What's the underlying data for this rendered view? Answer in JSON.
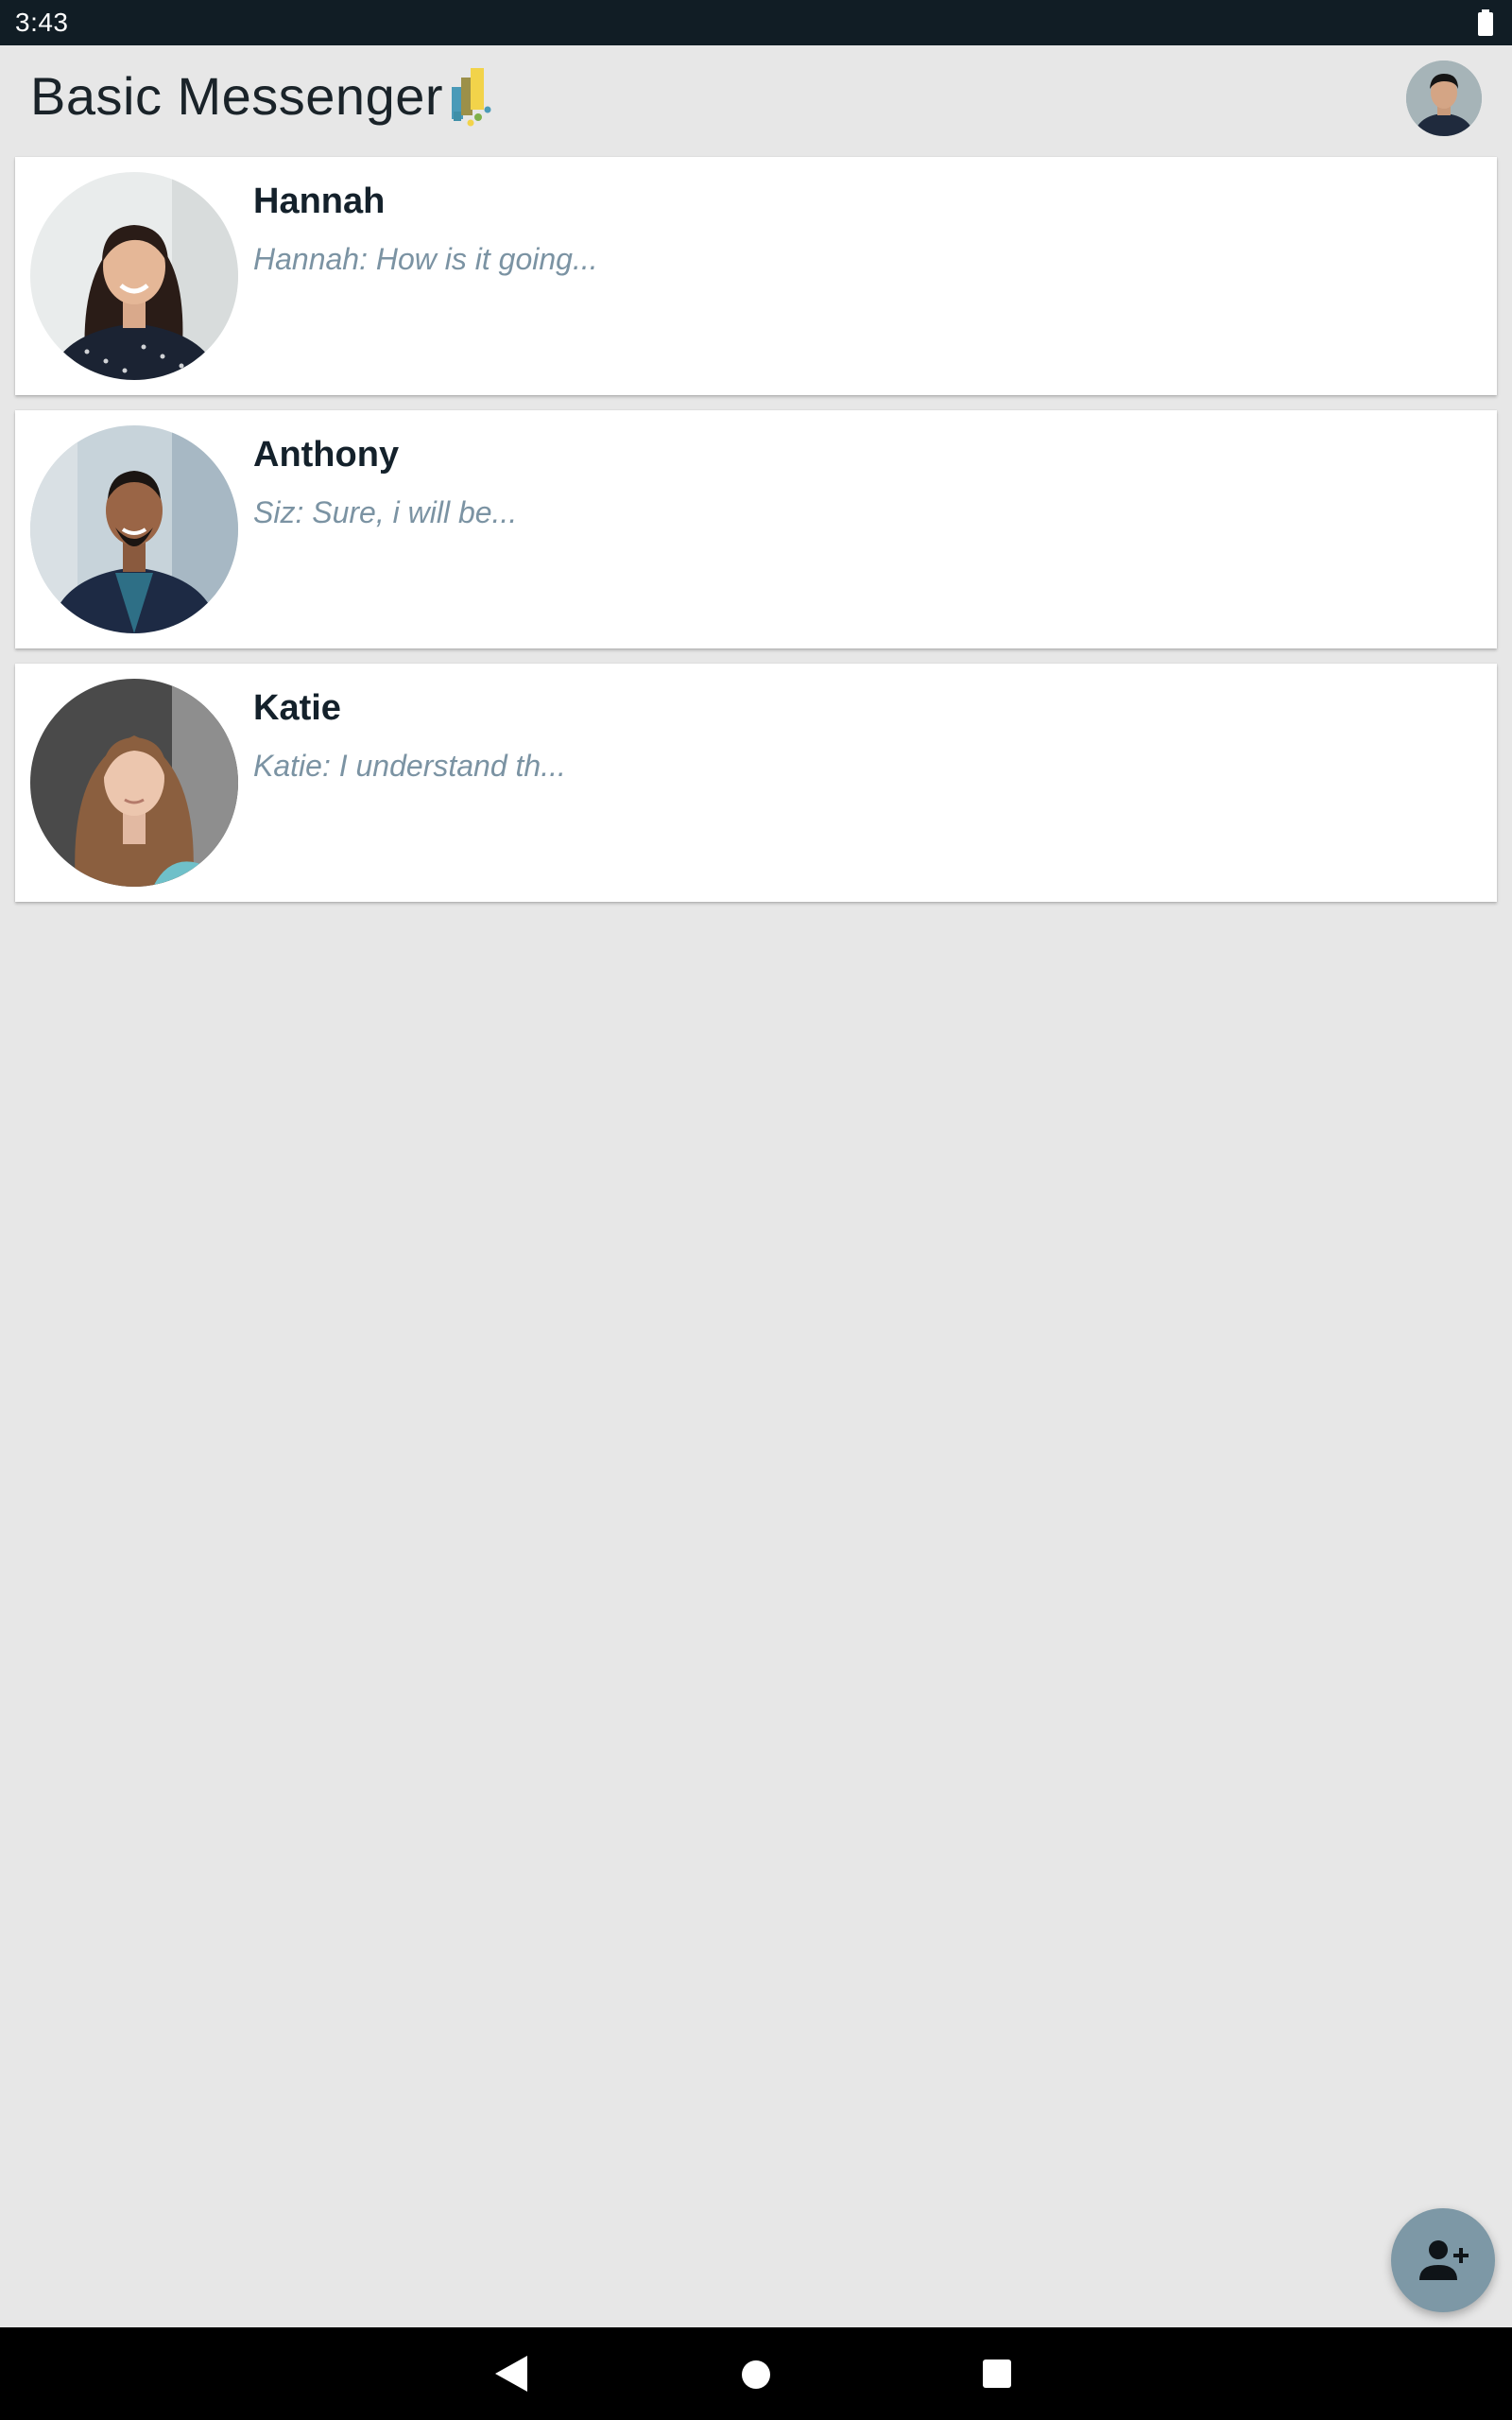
{
  "status_bar": {
    "time": "3:43",
    "battery_icon": "battery-full-icon"
  },
  "header": {
    "title": "Basic Messenger",
    "logo_icon": "app-logo-icon",
    "profile_avatar": "user-avatar"
  },
  "conversations": [
    {
      "name": "Hannah",
      "preview": "Hannah: How is it going..."
    },
    {
      "name": "Anthony",
      "preview": "Siz: Sure, i will be..."
    },
    {
      "name": "Katie",
      "preview": "Katie: I understand th..."
    }
  ],
  "fab": {
    "icon": "person-add-icon",
    "color": "#7d98a6"
  },
  "nav": {
    "back_icon": "back-icon",
    "home_icon": "home-icon",
    "recents_icon": "recents-icon"
  },
  "colors": {
    "background": "#e7e7e7",
    "status_bar": "#111d25",
    "title_text": "#1a2329",
    "name_text": "#14212b",
    "preview_text": "#7b93a3"
  }
}
